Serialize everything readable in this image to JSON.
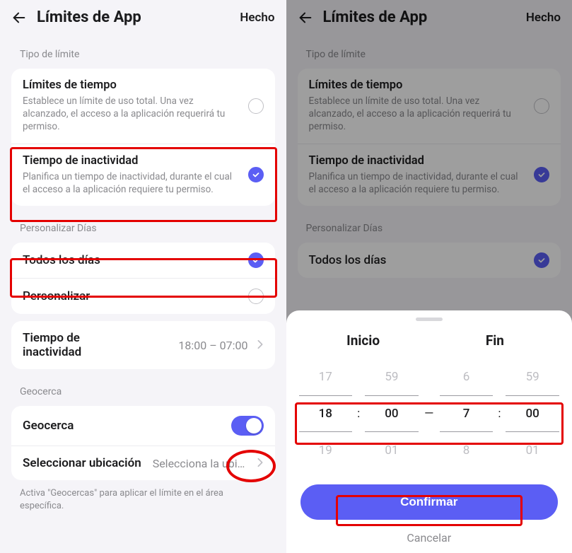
{
  "header": {
    "title": "Límites de App",
    "done": "Hecho"
  },
  "left": {
    "type_label": "Tipo de límite",
    "time_limits": {
      "title": "Límites de tiempo",
      "desc": "Establece un límite de uso total. Una vez alcanzado, el acceso a la aplicación requerirá tu permiso."
    },
    "downtime": {
      "title": "Tiempo de inactividad",
      "desc": "Planifica un tiempo de inactividad, durante el cual el acceso a la aplicación requiere tu permiso."
    },
    "customize_label": "Personalizar Días",
    "every_day": "Todos los días",
    "customize": "Personalizar",
    "downtime_row": {
      "title": "Tiempo de inactividad",
      "value": "18:00 – 07:00"
    },
    "geo_label": "Geocerca",
    "geo_toggle": "Geocerca",
    "geo_select": {
      "title": "Seleccionar ubicación",
      "value": "Selecciona la ubicaci…"
    },
    "geo_foot": "Activa \"Geocercas\" para aplicar el límite en el área específica."
  },
  "right": {
    "customize_label": "Personalizar Días",
    "every_day": "Todos los días"
  },
  "sheet": {
    "start": "Inicio",
    "end": "Fin",
    "hStartPrev": "17",
    "hStart": "18",
    "hStartNext": "19",
    "mStartPrev": "59",
    "mStart": "00",
    "mStartNext": "01",
    "dash": "—",
    "hEndPrev": "6",
    "hEnd": "7",
    "hEndNext": "8",
    "mEndPrev": "59",
    "mEnd": "00",
    "mEndNext": "01",
    "confirm": "Confirmar",
    "cancel": "Cancelar"
  },
  "colors": {
    "accent": "#5b5ef4",
    "annotation": "#e40000"
  }
}
